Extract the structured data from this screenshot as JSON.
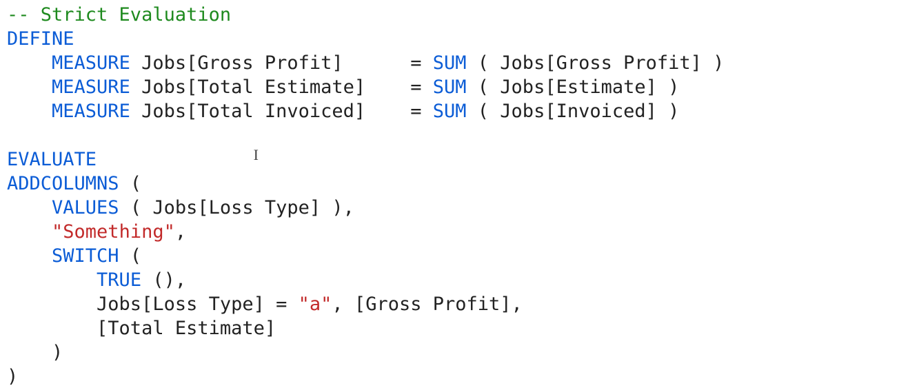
{
  "code": {
    "comment": "-- Strict Evaluation",
    "define": "DEFINE",
    "measure_kw": "MEASURE",
    "m1_name": " Jobs[Gross Profit]     ",
    "m1_eq": " = ",
    "m1_func": "SUM",
    "m1_args": " ( Jobs[Gross Profit] )",
    "m2_name": " Jobs[Total Estimate]   ",
    "m2_eq": " = ",
    "m2_func": "SUM",
    "m2_args": " ( Jobs[Estimate] )",
    "m3_name": " Jobs[Total Invoiced]   ",
    "m3_eq": " = ",
    "m3_func": "SUM",
    "m3_args": " ( Jobs[Invoiced] )",
    "evaluate": "EVALUATE",
    "addcolumns": "ADDCOLUMNS",
    "addcolumns_open": " (",
    "values": "VALUES",
    "values_args": " ( Jobs[Loss Type] ),",
    "str_something": "\"Something\"",
    "comma": ",",
    "switch": "SWITCH",
    "switch_open": " (",
    "true": "TRUE",
    "true_args": " (),",
    "switch_line_lhs": "        Jobs[Loss Type] = ",
    "str_a": "\"a\"",
    "switch_line_rhs": ", [Gross Profit],",
    "total_estimate_line": "        [Total Estimate]",
    "close_paren_indent1": "    )",
    "close_paren_indent0": ")",
    "indent1": "    ",
    "indent2": "        "
  }
}
